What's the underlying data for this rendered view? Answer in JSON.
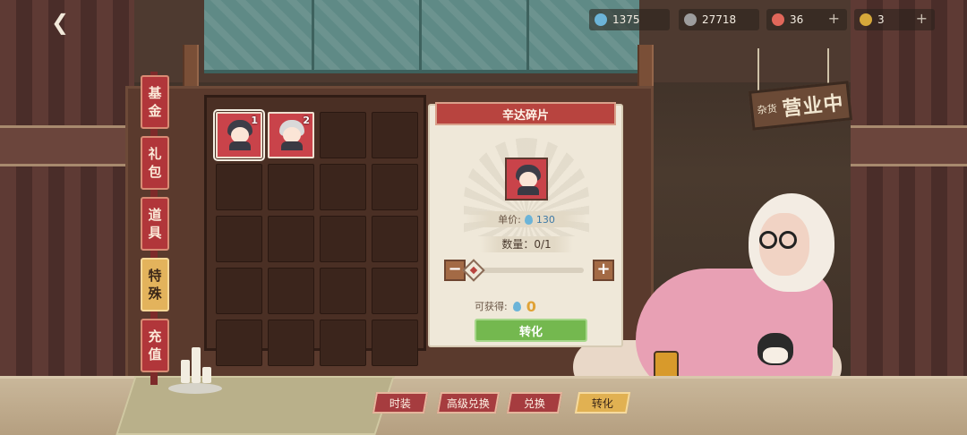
{
  "resources": [
    {
      "name": "gem",
      "value": "1375",
      "icon": "droplet-icon",
      "color": "#6cb4d8",
      "has_plus": false
    },
    {
      "name": "coin",
      "value": "27718",
      "icon": "coin-icon",
      "color": "#9d9d9d",
      "has_plus": false
    },
    {
      "name": "stamina",
      "value": "36",
      "icon": "potion-icon",
      "color": "#e1675a",
      "has_plus": true
    },
    {
      "name": "token",
      "value": "3",
      "icon": "gold-coin-icon",
      "color": "#d6a83a",
      "has_plus": true
    }
  ],
  "plus_symbol": "+",
  "back_icon": "back-icon",
  "shop_sign": {
    "small": "杂货",
    "big": "营业中"
  },
  "side_tabs": [
    {
      "label_top": "基",
      "label_bottom": "金",
      "active": false
    },
    {
      "label_top": "礼",
      "label_bottom": "包",
      "active": false
    },
    {
      "label_top": "道",
      "label_bottom": "具",
      "active": false
    },
    {
      "label_top": "特",
      "label_bottom": "殊",
      "active": true
    },
    {
      "label_top": "充",
      "label_bottom": "值",
      "active": false
    }
  ],
  "inventory": {
    "items": [
      {
        "count": "1",
        "hair_color": "#3d3d48",
        "selected": true
      },
      {
        "count": "2",
        "hair_color": "#d9d9d9",
        "selected": false
      }
    ],
    "total_slots": 20
  },
  "detail": {
    "title": "辛达碎片",
    "price_label": "单价:",
    "price_value": "130",
    "quantity_label": "数量：0/1",
    "minus_symbol": "−",
    "plus_symbol": "+",
    "slider_value": 0,
    "obtain_label": "可获得:",
    "obtain_value": "0",
    "convert_label": "转化"
  },
  "bottom_tabs": [
    {
      "label": "时装",
      "active": false
    },
    {
      "label": "高级兑换",
      "active": false
    },
    {
      "label": "兑换",
      "active": false
    },
    {
      "label": "转化",
      "active": true
    }
  ]
}
